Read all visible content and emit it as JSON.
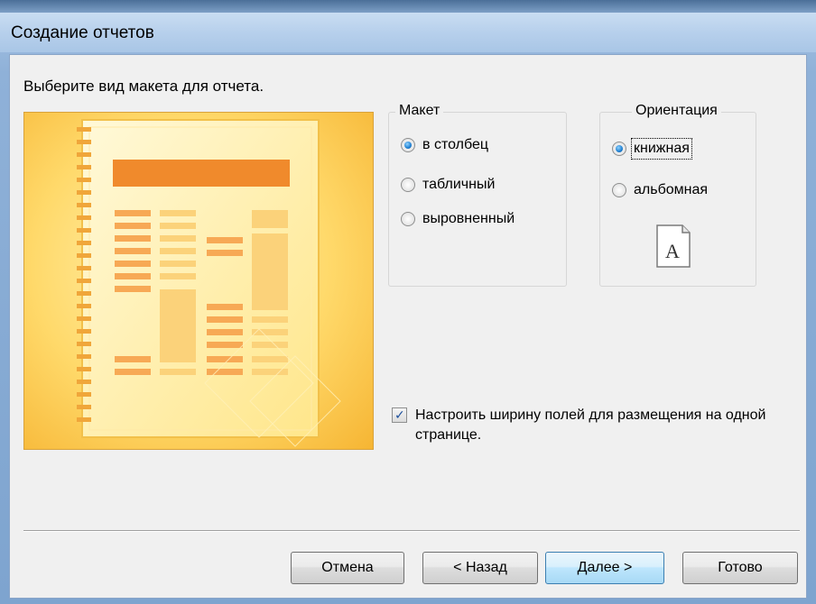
{
  "window": {
    "title": "Создание отчетов"
  },
  "wizard": {
    "prompt": "Выберите вид макета для отчета.",
    "layout_group": {
      "legend": "Макет",
      "options": [
        {
          "label": "в столбец",
          "checked": true
        },
        {
          "label": "табличный",
          "checked": false
        },
        {
          "label": "выровненный",
          "checked": false
        }
      ]
    },
    "orientation_group": {
      "legend": "Ориентация",
      "options": [
        {
          "label": "книжная",
          "checked": true
        },
        {
          "label": "альбомная",
          "checked": false
        }
      ],
      "page_icon_letter": "A"
    },
    "fit_width_checkbox": {
      "label": "Настроить ширину полей для размещения на одной странице.",
      "checked": true
    }
  },
  "buttons": {
    "cancel": "Отмена",
    "back": "< Назад",
    "next": "Далее >",
    "finish": "Готово"
  },
  "colors": {
    "preview_accent": "#f08a2c",
    "radio_checked": "#1f7fd0",
    "default_button_border": "#3c7fb1"
  }
}
